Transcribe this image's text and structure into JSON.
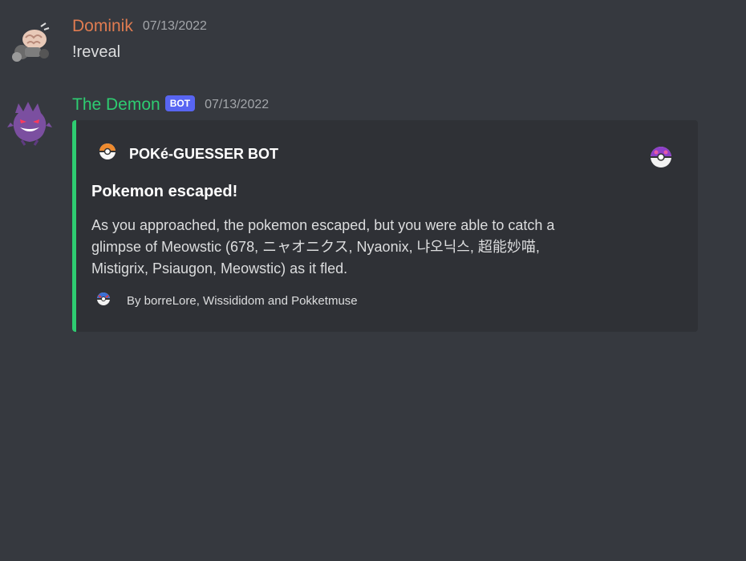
{
  "messages": [
    {
      "username": "Dominik",
      "timestamp": "07/13/2022",
      "content": "!reveal",
      "avatar_icon": "brain-avatar-icon",
      "username_color": "#e07c51"
    },
    {
      "username": "The Demon",
      "badge": "BOT",
      "timestamp": "07/13/2022",
      "avatar_icon": "gengar-avatar-icon",
      "username_color": "#2ecc71",
      "embed": {
        "accent_color": "#2ecc71",
        "author_icon": "pokeball-icon",
        "author": "POKé-GUESSER BOT",
        "thumbnail_icon": "master-ball-icon",
        "title": "Pokemon escaped!",
        "description": "As you approached, the pokemon escaped, but you were able to catch a glimpse of Meowstic (678, ニャオニクス, Nyaonix, 냐오닉스, 超能妙喵, Mistigrix, Psiaugon, Meowstic) as it fled.",
        "footer_icon": "great-ball-icon",
        "footer": "By borreLore, Wissididom and Pokketmuse"
      }
    }
  ],
  "colors": {
    "background": "#36393f",
    "embed_background": "#2f3136",
    "bot_badge": "#5865f2",
    "timestamp": "#a3a6aa"
  }
}
